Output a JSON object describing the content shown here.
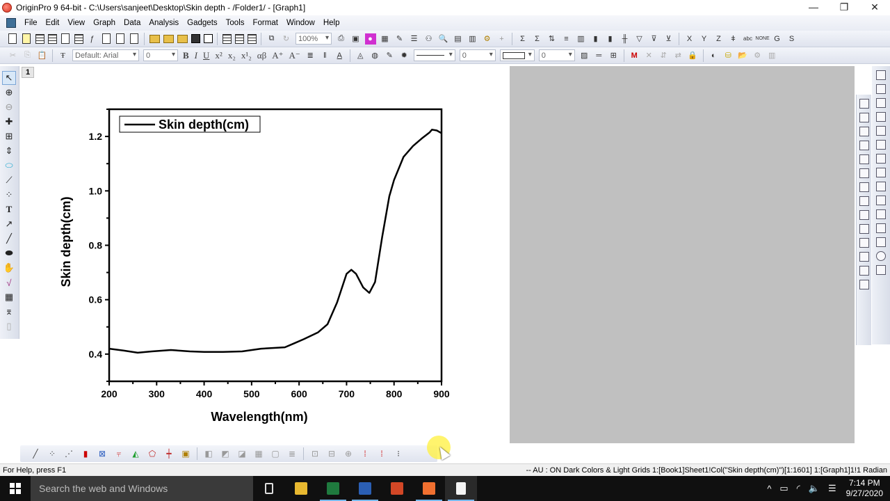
{
  "window": {
    "title": "OriginPro 9 64-bit - C:\\Users\\sanjeet\\Desktop\\Skin depth - /Folder1/ - [Graph1]",
    "controls": {
      "minimize": "—",
      "restore": "❐",
      "close": "✕"
    },
    "mdi_controls": "- ❐ ✕"
  },
  "menu": [
    "File",
    "Edit",
    "View",
    "Graph",
    "Data",
    "Analysis",
    "Gadgets",
    "Tools",
    "Format",
    "Window",
    "Help"
  ],
  "toolbar": {
    "zoom_value": "100%",
    "font_name": "Default: Arial",
    "font_size": "0",
    "line_width": "0",
    "border_width": "0",
    "format_buttons": [
      "B",
      "I",
      "U",
      "x²",
      "x₂",
      "x¹₂",
      "αβ",
      "A⁺",
      "A⁻"
    ],
    "column_buttons": [
      "X",
      "Y",
      "Z",
      "G",
      "S"
    ]
  },
  "graph": {
    "layer_number": "1"
  },
  "chart_data": {
    "type": "line",
    "title": "",
    "xlabel": "Wavelength(nm)",
    "ylabel": "Skin depth(cm)",
    "xlim": [
      200,
      900
    ],
    "ylim": [
      0.3,
      1.3
    ],
    "xticks": [
      "200",
      "300",
      "400",
      "500",
      "600",
      "700",
      "800",
      "900"
    ],
    "yticks": [
      "0.4",
      "0.6",
      "0.8",
      "1.0",
      "1.2"
    ],
    "grid": false,
    "legend": {
      "position": "top-left",
      "entries": [
        "Skin depth(cm)"
      ]
    },
    "series": [
      {
        "name": "Skin depth(cm)",
        "color": "#000000",
        "x": [
          200,
          230,
          260,
          290,
          330,
          370,
          400,
          440,
          480,
          520,
          570,
          590,
          610,
          640,
          660,
          680,
          700,
          710,
          720,
          735,
          748,
          760,
          775,
          790,
          800,
          820,
          840,
          860,
          875,
          880,
          890,
          900
        ],
        "y": [
          0.42,
          0.413,
          0.405,
          0.41,
          0.415,
          0.41,
          0.408,
          0.408,
          0.41,
          0.42,
          0.425,
          0.44,
          0.455,
          0.48,
          0.51,
          0.59,
          0.695,
          0.71,
          0.695,
          0.645,
          0.625,
          0.665,
          0.83,
          0.98,
          1.04,
          1.125,
          1.165,
          1.195,
          1.215,
          1.225,
          1.222,
          1.212
        ]
      }
    ]
  },
  "statusbar": {
    "help": "For Help, press F1",
    "right": "-- AU : ON  Dark Colors & Light Grids  1:[Book1]Sheet1!Col(\"Skin depth(cm)\")[1:1601]  1:[Graph1]1!1  Radian"
  },
  "taskbar": {
    "search_placeholder": "Search the web and Windows",
    "time": "7:14 PM",
    "date": "9/27/2020",
    "apps": [
      {
        "name": "task-view",
        "color": "#101010"
      },
      {
        "name": "file-explorer",
        "color": "#e8b830"
      },
      {
        "name": "excel",
        "color": "#1f7a3e"
      },
      {
        "name": "word",
        "color": "#2b5fb4"
      },
      {
        "name": "powerpoint",
        "color": "#d24726"
      },
      {
        "name": "screen-recorder",
        "color": "#f07030"
      },
      {
        "name": "notepad",
        "color": "#f4f4f4"
      }
    ]
  }
}
